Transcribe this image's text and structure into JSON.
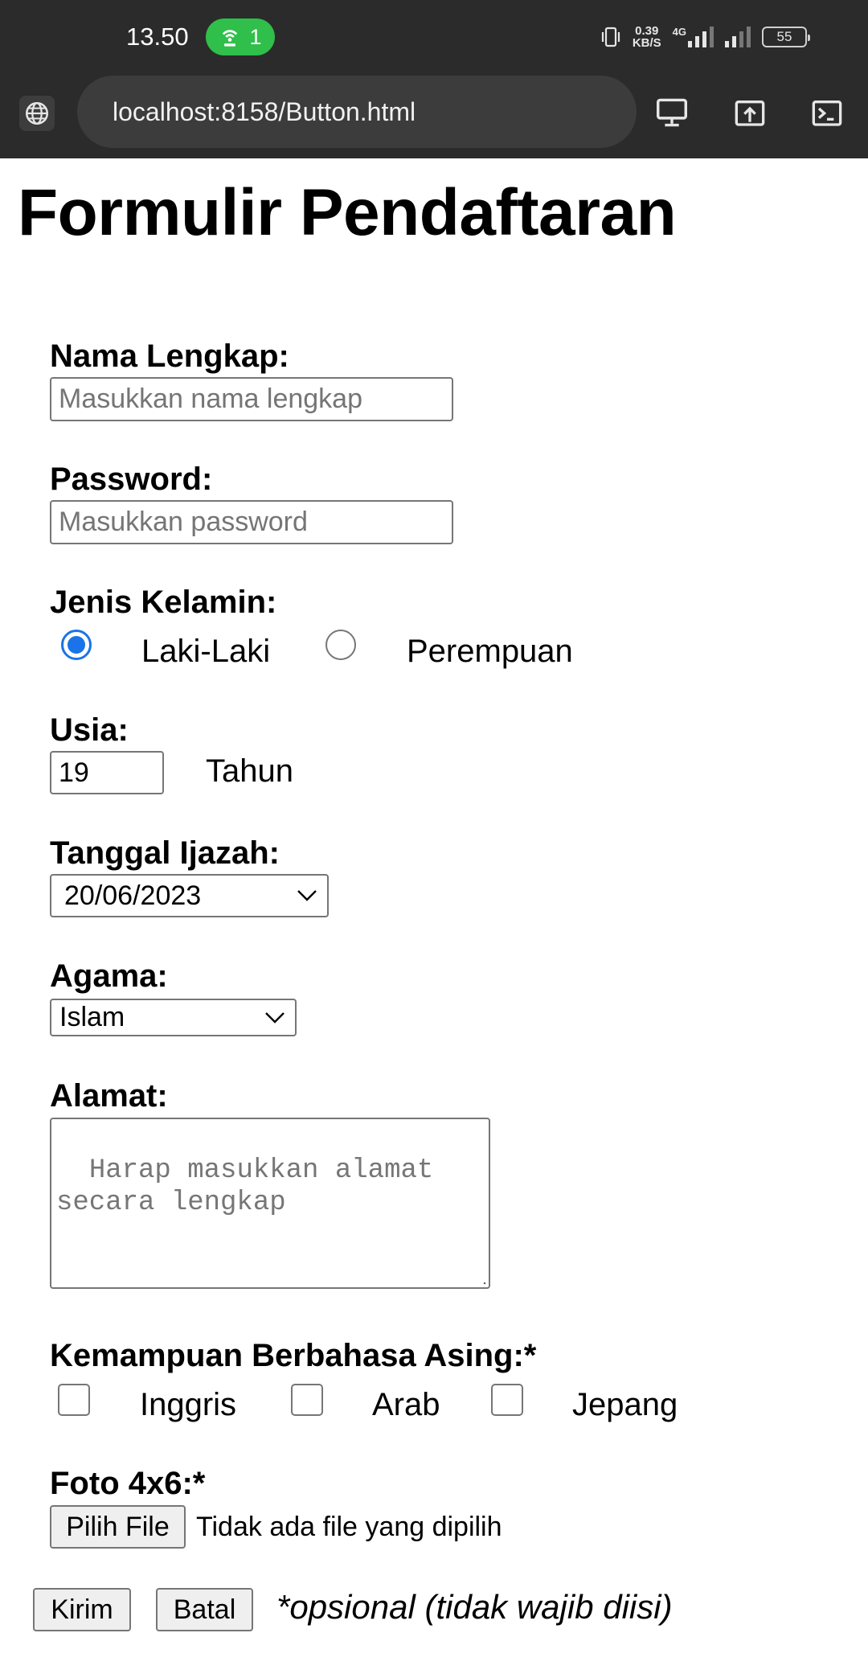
{
  "status_bar": {
    "time": "13.50",
    "hotspot_count": "1",
    "net_speed_value": "0.39",
    "net_speed_unit": "KB/S",
    "network_type": "4G",
    "battery": "55"
  },
  "browser": {
    "url": "localhost:8158/Button.html"
  },
  "form": {
    "title": "Formulir Pendaftaran",
    "name": {
      "label": "Nama Lengkap:",
      "placeholder": "Masukkan nama lengkap",
      "value": ""
    },
    "password": {
      "label": "Password:",
      "placeholder": "Masukkan password",
      "value": ""
    },
    "gender": {
      "label": "Jenis Kelamin:",
      "options": [
        "Laki-Laki",
        "Perempuan"
      ],
      "selected": "Laki-Laki"
    },
    "age": {
      "label": "Usia:",
      "value": "19",
      "unit": "Tahun"
    },
    "graduation_date": {
      "label": "Tanggal Ijazah:",
      "value": "20/06/2023"
    },
    "religion": {
      "label": "Agama:",
      "value": "Islam"
    },
    "address": {
      "label": "Alamat:",
      "placeholder": "Harap masukkan alamat\nsecara lengkap",
      "value": ""
    },
    "languages": {
      "label": "Kemampuan Berbahasa Asing:*",
      "options": [
        "Inggris",
        "Arab",
        "Jepang"
      ],
      "checked": []
    },
    "photo": {
      "label": "Foto 4x6:*",
      "button_label": "Pilih File",
      "status": "Tidak ada file yang dipilih"
    },
    "submit_label": "Kirim",
    "reset_label": "Batal",
    "optional_note": "*opsional (tidak wajib diisi)"
  },
  "colors": {
    "chrome_bg": "#2b2b2b",
    "url_bar_bg": "#3c3c3c",
    "hotspot_green": "#2fbf4a",
    "radio_accent": "#1a73e8",
    "field_border": "#767676",
    "placeholder": "#767676"
  },
  "icons": {
    "site_info": "globe-icon",
    "desktop_mode": "desktop-icon",
    "share": "share-upload-icon",
    "console": "terminal-icon",
    "hotspot": "hotspot-icon",
    "vibrate": "vibrate-icon"
  }
}
